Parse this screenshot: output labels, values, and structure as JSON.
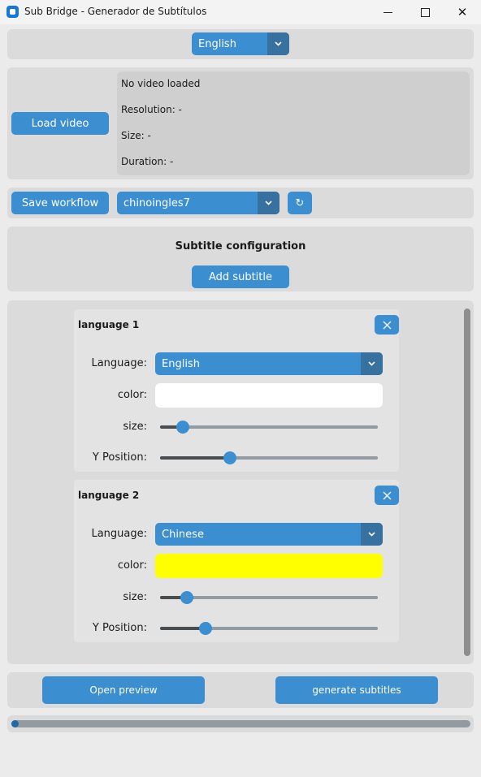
{
  "window": {
    "title": "Sub Bridge - Generador de Subtítulos",
    "close_glyph": "✕"
  },
  "ui_language": {
    "selected": "English"
  },
  "video": {
    "load_button": "Load video",
    "status": "No video loaded",
    "resolution": "Resolution: -",
    "size": "Size: -",
    "duration": "Duration: -"
  },
  "workflow": {
    "save_button": "Save workflow",
    "selected": "chinoingles7",
    "refresh_glyph": "↻"
  },
  "subtitle_config": {
    "title": "Subtitle configuration",
    "add_button": "Add subtitle"
  },
  "subtitles": [
    {
      "title": "language 1",
      "language_label": "Language:",
      "language": "English",
      "color_label": "color:",
      "color": "#ffffff",
      "size_label": "size:",
      "size_fraction": 0.08,
      "ypos_label": "Y Position:",
      "ypos_fraction": 0.31
    },
    {
      "title": "language 2",
      "language_label": "Language:",
      "language": "Chinese",
      "color_label": "color:",
      "color": "#ffff00",
      "size_label": "size:",
      "size_fraction": 0.1,
      "ypos_label": "Y Position:",
      "ypos_fraction": 0.19
    }
  ],
  "actions": {
    "preview_button": "Open preview",
    "generate_button": "generate subtitles"
  },
  "progress": {
    "fraction": 0.01
  },
  "colors": {
    "accent": "#3b8ed0",
    "accent_dark": "#36719f",
    "frame": "#dbdbdb",
    "background": "#ebebeb"
  }
}
